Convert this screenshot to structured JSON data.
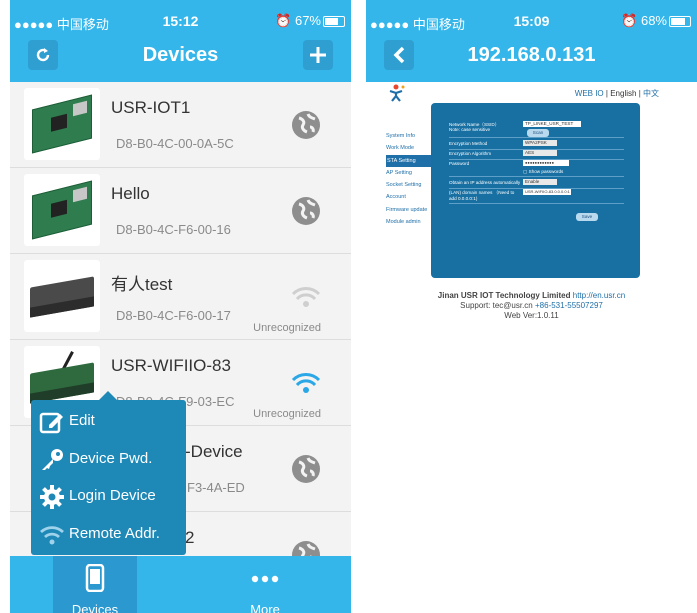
{
  "left": {
    "status": {
      "carrier": "●●●●● 中国移动",
      "time": "15:12",
      "battery": "67%",
      "battery_level": 0.67
    },
    "nav": {
      "title": "Devices",
      "refresh_icon": "refresh-icon",
      "add_icon": "plus-icon"
    },
    "devices": [
      {
        "name": "USR-IOT1",
        "mac": "D8-B0-4C-00-0A-5C",
        "status": "",
        "icon": "globe-icon"
      },
      {
        "name": "Hello",
        "mac": "D8-B0-4C-F6-00-16",
        "status": "",
        "icon": "globe-icon"
      },
      {
        "name": "有人test",
        "mac": "D8-B0-4C-F6-00-17",
        "status": "Unrecognized",
        "icon": "wifi-grey-icon"
      },
      {
        "name": "USR-WIFIIO-83",
        "mac": "D8-B0-4C-F9-03-EC",
        "status": "Unrecognized",
        "icon": "wifi-blue-icon"
      },
      {
        "name": "-Device",
        "mac": "F3-4A-ED",
        "status": "",
        "icon": "globe-icon"
      },
      {
        "name": "2",
        "mac": "",
        "status": "",
        "icon": "globe-icon"
      }
    ],
    "menu": [
      {
        "label": "Edit",
        "icon": "edit-icon"
      },
      {
        "label": "Device Pwd.",
        "icon": "key-icon"
      },
      {
        "label": "Login Device",
        "icon": "gear-icon"
      },
      {
        "label": "Remote Addr.",
        "icon": "wifi-icon"
      }
    ],
    "tabs": [
      {
        "label": "Devices",
        "icon": "phone-icon"
      },
      {
        "label": "More",
        "icon": "more-dots-icon"
      }
    ]
  },
  "right": {
    "status": {
      "carrier": "●●●●● 中国移动",
      "time": "15:09",
      "battery": "68%",
      "battery_level": 0.68
    },
    "nav": {
      "title": "192.168.0.131",
      "back_icon": "back-chevron-icon"
    },
    "web": {
      "lang_links": [
        "WEB IO",
        "English",
        "中文"
      ],
      "sep": "|",
      "sidebar": [
        "System Info",
        "Work Mode",
        "STA Setting",
        "AP Setting",
        "Socket Setting",
        "Account",
        "Firmware update",
        "Module admin"
      ],
      "active_sidebar": "STA Setting",
      "fields": [
        {
          "label": "Network Name（SSID）",
          "value": "TP_LINKE_USR_TEST"
        },
        {
          "label": "Note: case sensitive",
          "value": "Scan"
        },
        {
          "label": "Encryption Method",
          "value": "WPA2PSK"
        },
        {
          "label": "Encryption Algorithm",
          "value": "AES"
        },
        {
          "label": "Password",
          "value": "●●●●●●●●●●●●"
        },
        {
          "label": "",
          "value": "Show passwords"
        },
        {
          "label": "Obtain an IP address automatically",
          "value": "Enable"
        },
        {
          "label": "(LAN) domain names （Need to add 0.0.0.0:1)",
          "value": "USR-WIFIIO-83.0.0.0.0:1"
        }
      ],
      "save_label": "Save",
      "footer": {
        "company": "Jinan USR IOT Technology Limited",
        "company_url": "http://en.usr.cn",
        "support_prefix": "Support: tec@usr.cn",
        "phone": "+86-531-55507297",
        "version": "Web Ver:1.0.11"
      }
    }
  },
  "colors": {
    "accent": "#35b6ea",
    "popover": "#1e88b6",
    "panel": "#176fa2",
    "wifi_active": "#2aa7e6"
  }
}
